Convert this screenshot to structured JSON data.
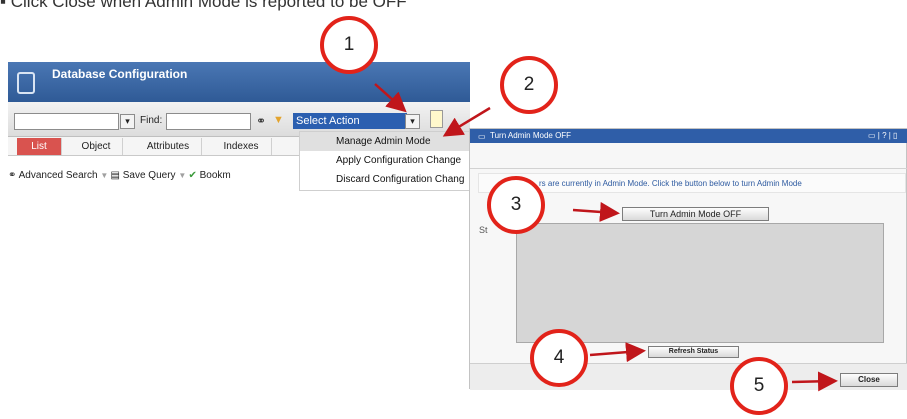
{
  "caption": "Click Close when Admin Mode is reported to be OFF",
  "left_window": {
    "title": "Database Configuration",
    "find_label": "Find:",
    "select_action": "Select Action",
    "tabs": [
      "List",
      "Object",
      "Attributes",
      "Indexes"
    ],
    "query_bar": {
      "advanced_search": "Advanced Search",
      "save_query": "Save Query",
      "bookmarks": "Bookm"
    },
    "menu_items": [
      "Manage Admin Mode",
      "Apply Configuration Change",
      "Discard Configuration Chang"
    ]
  },
  "dialog": {
    "title": "Turn Admin Mode OFF",
    "controls": "▭ | ? | ▯",
    "info_text": "rs are currently in Admin Mode. Click the button below to turn Admin Mode",
    "turn_off_button": "Turn Admin Mode OFF",
    "status_label": "St",
    "refresh_button": "Refresh Status",
    "close_button": "Close"
  },
  "annotations": [
    "1",
    "2",
    "3",
    "4",
    "5"
  ],
  "colors": {
    "annotation_red": "#e2231a",
    "title_blue": "#2f5ea8",
    "selection_blue": "#2b5fb0"
  }
}
